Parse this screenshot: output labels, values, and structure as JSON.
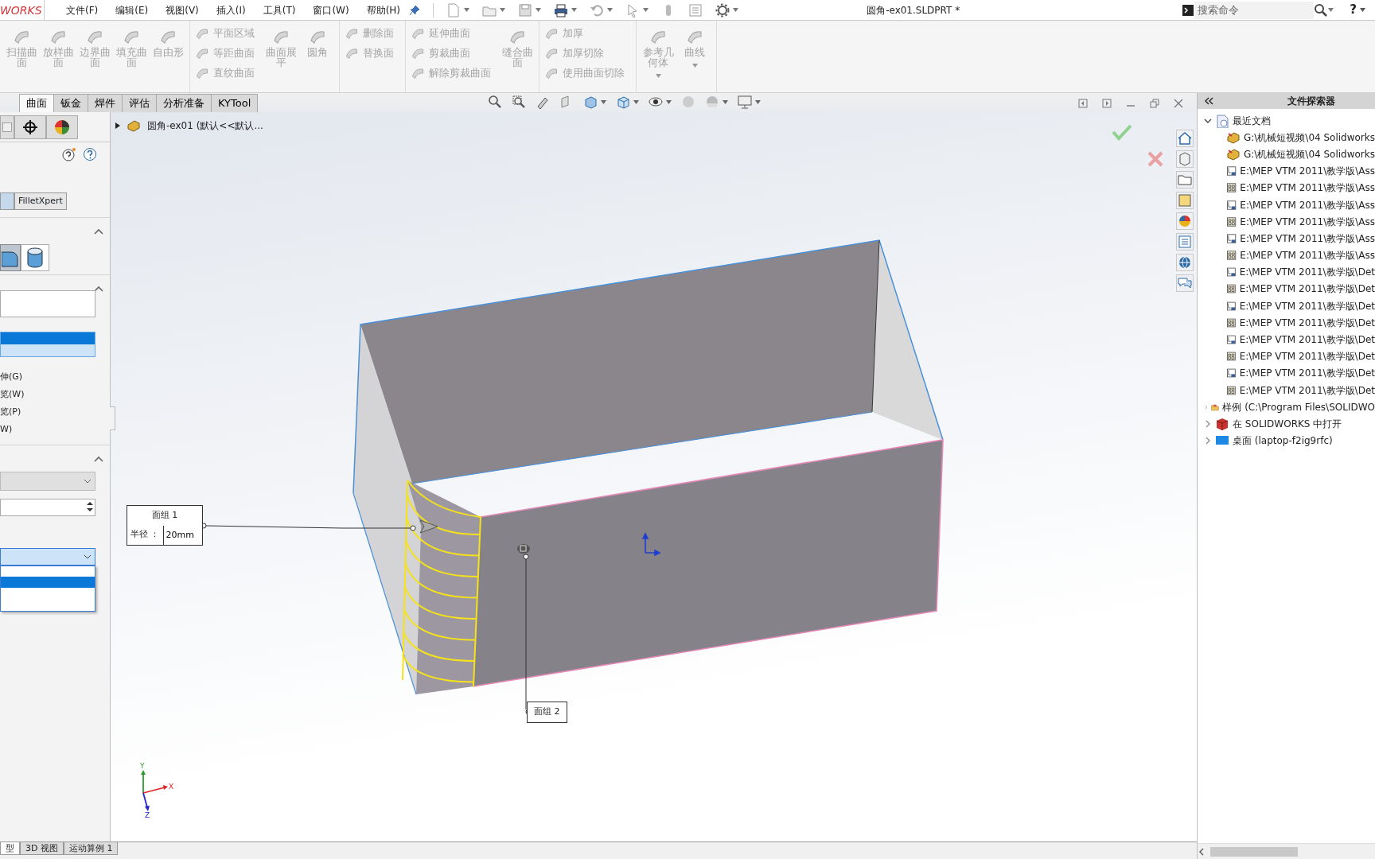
{
  "app": {
    "logo": "WORKS",
    "menus": [
      "文件(F)",
      "编辑(E)",
      "视图(V)",
      "插入(I)",
      "工具(T)",
      "窗口(W)",
      "帮助(H)"
    ],
    "title": "圆角-ex01.SLDPRT *",
    "search": {
      "placeholder": "搜索命令"
    },
    "help": "?"
  },
  "ribbon": {
    "groups": [
      [
        {
          "kind": "large",
          "items": [
            "扫描曲面",
            "放样曲面",
            "边界曲面",
            "填充曲面",
            "自由形"
          ]
        }
      ],
      [
        {
          "kind": "stack",
          "items": [
            "平面区域",
            "等距曲面",
            "直纹曲面"
          ]
        },
        {
          "kind": "large",
          "items": [
            "曲面展平",
            "圆角"
          ]
        }
      ],
      [
        {
          "kind": "stack",
          "items": [
            "删除面",
            "替换面"
          ]
        }
      ],
      [
        {
          "kind": "stack",
          "items": [
            "延伸曲面",
            "剪裁曲面",
            "解除剪裁曲面"
          ]
        },
        {
          "kind": "large",
          "items": [
            "缝合曲面"
          ]
        }
      ],
      [
        {
          "kind": "stack",
          "items": [
            "加厚",
            "加厚切除",
            "使用曲面切除"
          ]
        }
      ],
      [
        {
          "kind": "large",
          "dropdown": true,
          "items": [
            "参考几何体",
            "曲线"
          ]
        }
      ]
    ]
  },
  "tabs": [
    {
      "label": "曲面",
      "selected": true
    },
    {
      "label": "钣金",
      "selected": false
    },
    {
      "label": "焊件",
      "selected": false
    },
    {
      "label": "评估",
      "selected": false
    },
    {
      "label": "分析准备",
      "selected": false
    },
    {
      "label": "KYTool",
      "selected": false
    }
  ],
  "property_manager": {
    "mode_button": "FilletXpert",
    "options": [
      "伸(G)",
      "览(W)",
      "览(P)",
      "W)"
    ]
  },
  "feature_tree": {
    "title": "圆角-ex01  (默认<<默认..."
  },
  "callouts": [
    {
      "title": "面组 1",
      "label": "半径 ：",
      "value": "20mm"
    },
    {
      "title": "面组 2"
    }
  ],
  "triad": {
    "x": "X",
    "y": "Y",
    "z": "Z"
  },
  "file_explorer": {
    "title": "文件探索器",
    "items": [
      {
        "label": "最近文档",
        "kind": "recent",
        "expanded": true,
        "children": [
          {
            "label": "G:\\机械短视频\\04 Solidworks",
            "kind": "part"
          },
          {
            "label": "G:\\机械短视频\\04 Solidworks",
            "kind": "part"
          },
          {
            "label": "E:\\MEP VTM 2011\\教学版\\Ass",
            "kind": "drawing"
          },
          {
            "label": "E:\\MEP VTM 2011\\教学版\\Ass",
            "kind": "layout"
          },
          {
            "label": "E:\\MEP VTM 2011\\教学版\\Ass",
            "kind": "drawing"
          },
          {
            "label": "E:\\MEP VTM 2011\\教学版\\Ass",
            "kind": "layout"
          },
          {
            "label": "E:\\MEP VTM 2011\\教学版\\Ass",
            "kind": "drawing"
          },
          {
            "label": "E:\\MEP VTM 2011\\教学版\\Ass",
            "kind": "layout"
          },
          {
            "label": "E:\\MEP VTM 2011\\教学版\\Det",
            "kind": "drawing"
          },
          {
            "label": "E:\\MEP VTM 2011\\教学版\\Det",
            "kind": "layout"
          },
          {
            "label": "E:\\MEP VTM 2011\\教学版\\Det",
            "kind": "drawing"
          },
          {
            "label": "E:\\MEP VTM 2011\\教学版\\Det",
            "kind": "layout"
          },
          {
            "label": "E:\\MEP VTM 2011\\教学版\\Det",
            "kind": "drawing"
          },
          {
            "label": "E:\\MEP VTM 2011\\教学版\\Det",
            "kind": "layout"
          },
          {
            "label": "E:\\MEP VTM 2011\\教学版\\Det",
            "kind": "drawing"
          },
          {
            "label": "E:\\MEP VTM 2011\\教学版\\Det",
            "kind": "layout"
          }
        ]
      },
      {
        "label": "样例 (C:\\Program Files\\SOLIDWO",
        "kind": "samples",
        "expanded": false
      },
      {
        "label": "在 SOLIDWORKS 中打开",
        "kind": "app",
        "expanded": false
      },
      {
        "label": "桌面 (laptop-f2ig9rfc)",
        "kind": "desktop",
        "expanded": false
      }
    ]
  },
  "bottom_tabs": [
    {
      "label": "型",
      "selected": true
    },
    {
      "label": "3D 视图",
      "selected": false
    },
    {
      "label": "运动算例 1",
      "selected": false
    }
  ]
}
